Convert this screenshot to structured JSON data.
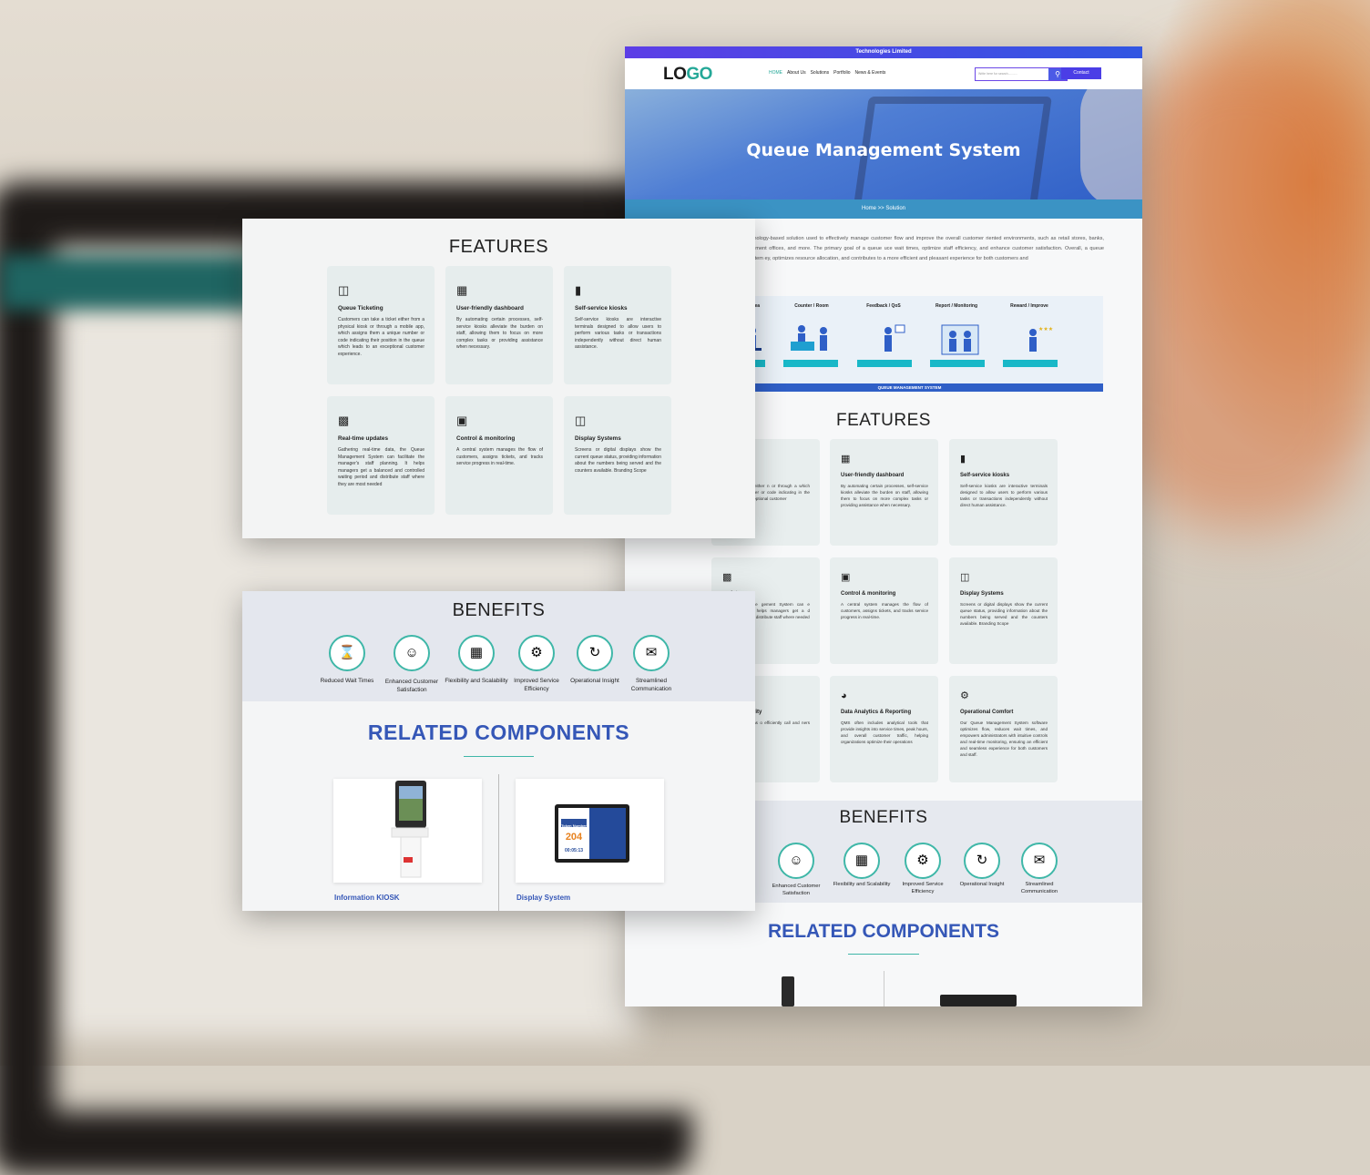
{
  "main": {
    "topbar": "Technologies Limited",
    "logo": {
      "part1": "LO",
      "part2": "GO"
    },
    "menu": [
      "HOME",
      "About Us",
      "Solutions",
      "Portfolio",
      "News & Events"
    ],
    "search_placeholder": "Write here for search...........",
    "search_icon": "search-icon",
    "contact_label": "Contact",
    "hero_title": "Queue Management System",
    "breadcrumb": "Home  >>  Solution",
    "intro": "(QMS) is a technology-based solution used to effectively manage customer flow and improve the overall customer riented environments, such as retail stores, banks, hospitals, government offices, and more. The primary goal of a queue uce wait times, optimize staff efficiency, and enhance customer satisfaction. Overall, a queue management system ey, optimizes resource allocation, and contributes to a more efficient and pleasant experience for both customers and",
    "diagram": {
      "stages": [
        "Waiting Area",
        "Counter / Room",
        "Feedback / QoS",
        "Report / Monitoring",
        "Reward / Improve"
      ],
      "bar_label": "QUEUE MANAGEMENT SYSTEM"
    },
    "features_title": "FEATURES",
    "features": [
      {
        "title": "eting",
        "desc": "n take a ticket either n or through a which assigns them a er or code indicating in the queue which exceptional customer",
        "icon": "ticket-icon"
      },
      {
        "title": "User-friendly dashboard",
        "desc": "By automating certain processes, self-service kiosks alleviate the burden on staff, allowing them to focus on more complex tasks or providing assistance when necessary.",
        "icon": "dashboard-icon"
      },
      {
        "title": "Self-service kiosks",
        "desc": "Self-service kiosks are interactive terminals designed to allow users to perform various tasks or transactions independently without direct human assistance.",
        "icon": "kiosk-icon"
      },
      {
        "title": "updates",
        "desc": "al-time data, the gement System can e manager's staff helps managers get a d controlled waiting distribute staff where needed",
        "icon": "chart-icon"
      },
      {
        "title": "Control & monitoring",
        "desc": "A central system manages the flow of customers, assigns tickets, and tracks service progress in real-time.",
        "icon": "monitor-icon"
      },
      {
        "title": "Display Systems",
        "desc": "Screens or digital displays show the current queue status, providing information about the numbers being served and the counters available. Branding Scope",
        "icon": "display-icon"
      },
      {
        "title": "aff productivity",
        "desc": "with service areas o efficiently call and ners based on their s.",
        "icon": "people-icon"
      },
      {
        "title": "Data Analytics & Reporting",
        "desc": "QMS often includes analytical tools that provide insights into service times, peak hours, and overall customer traffic, helping organizations optimize their operations",
        "icon": "analytics-icon"
      },
      {
        "title": "Operational Comfort",
        "desc": "Our Queue Management System software optimizes flow, reduces wait times, and empowers administrators with intuitive controls and real-time monitoring, ensuring an efficient and seamless experience for both customers and staff.",
        "icon": "comfort-icon"
      }
    ],
    "benefits_title": "BENEFITS",
    "benefits": [
      {
        "label": "Enhanced Customer Satisfaction",
        "icon": "customer-icon"
      },
      {
        "label": "Flexibility and Scalability",
        "icon": "scalability-icon"
      },
      {
        "label": "Improved Service Efficiency",
        "icon": "efficiency-icon"
      },
      {
        "label": "Operational Insight",
        "icon": "insight-icon"
      },
      {
        "label": "Streamlined Communication",
        "icon": "communication-icon"
      }
    ],
    "related_title": "RELATED COMPONENTS"
  },
  "overlay_features": {
    "title": "FEATURES",
    "cards": [
      {
        "title": "Queue Ticketing",
        "desc": "Customers can take a ticket either from a physical kiosk or through a mobile app, which assigns them a unique number or code indicating their position in the queue which leads to an exceptional customer experience.",
        "icon": "ticket-icon"
      },
      {
        "title": "User-friendly dashboard",
        "desc": "By automating certain processes, self-service kiosks alleviate the burden on staff, allowing them to focus on more complex tasks or providing assistance when necessary.",
        "icon": "dashboard-icon"
      },
      {
        "title": "Self-service kiosks",
        "desc": "Self-service kiosks are interactive terminals designed to allow users to perform various tasks or transactions independently without direct human assistance.",
        "icon": "kiosk-icon"
      },
      {
        "title": "Real-time updates",
        "desc": "Gathering real-time data, the Queue Management System can facilitate the manager's staff planning. It helps managers get a balanced and controlled waiting period and distribute staff where they are most needed",
        "icon": "chart-icon"
      },
      {
        "title": "Control & monitoring",
        "desc": "A central system manages the flow of customers, assigns tickets, and tracks service progress in real-time.",
        "icon": "monitor-icon"
      },
      {
        "title": "Display Systems",
        "desc": "Screens or digital displays show the current queue status, providing information about the numbers being served and the counters available. Branding Scope",
        "icon": "display-icon"
      }
    ]
  },
  "overlay_benefits": {
    "title": "BENEFITS",
    "items": [
      {
        "label": "Reduced Wait Times",
        "icon": "hourglass-icon"
      },
      {
        "label": "Enhanced Customer Satisfaction",
        "icon": "customer-icon"
      },
      {
        "label": "Flexibility and Scalability",
        "icon": "scalability-icon"
      },
      {
        "label": "Improved Service Efficiency",
        "icon": "efficiency-icon"
      },
      {
        "label": "Operational Insight",
        "icon": "insight-icon"
      },
      {
        "label": "Streamlined Communication",
        "icon": "communication-icon"
      }
    ],
    "related_title": "RELATED COMPONENTS",
    "products": [
      {
        "name": "Information KIOSK",
        "icon": "kiosk-icon"
      },
      {
        "name": "Display System",
        "icon": "tablet-icon",
        "screen_label": "Token Number",
        "screen_number": "204",
        "screen_time": "00:05:13"
      }
    ]
  },
  "colors": {
    "accent": "#3557b7",
    "teal": "#3fb7a8",
    "nav_purple": "#4b3ee6"
  }
}
